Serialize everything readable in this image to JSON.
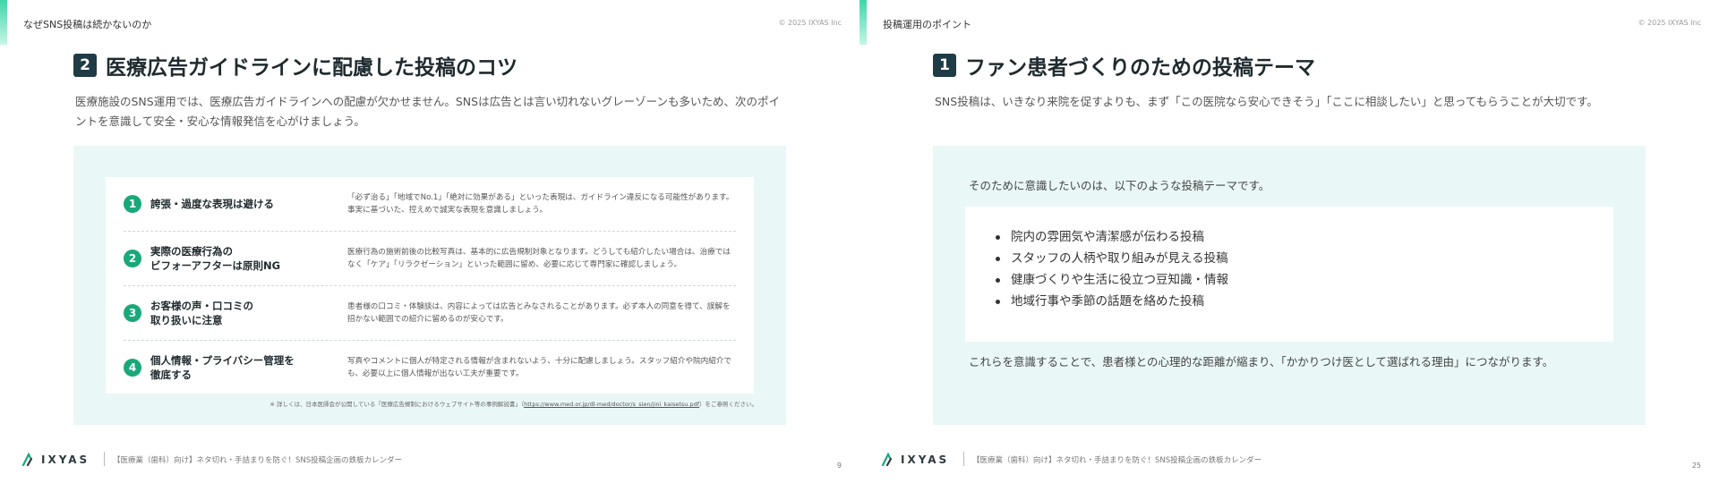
{
  "brand": {
    "accent": "#3dd6a8",
    "number_bg": "#1f3b45",
    "tip_number": "#1aa87a",
    "panel_bg": "#eaf7f7"
  },
  "left": {
    "section_label": "なぜSNS投稿は続かないのか",
    "copyright": "© 2025 IXYAS Inc",
    "title_number": "2",
    "title": "医療広告ガイドラインに配慮した投稿のコツ",
    "intro": "医療施設のSNS運用では、医療広告ガイドラインへの配慮が欠かせません。SNSは広告とは言い切れないグレーゾーンも多いため、次のポイントを意識して安全・安心な情報発信を心がけましょう。",
    "tips": [
      {
        "number": "1",
        "heading": "誇張・過度な表現は避ける",
        "description": "「必ず治る」「地域でNo.1」「絶対に効果がある」といった表現は、ガイドライン違反になる可能性があります。事実に基づいた、控えめで誠実な表現を意識しましょう。"
      },
      {
        "number": "2",
        "heading": "実際の医療行為の\nビフォーアフターは原則NG",
        "description": "医療行為の施術前後の比較写真は、基本的に広告規制対象となります。どうしても紹介したい場合は、治療ではなく「ケア」「リラクゼーション」といった範囲に留め、必要に応じて専門家に確認しましょう。"
      },
      {
        "number": "3",
        "heading": "お客様の声・口コミの\n取り扱いに注意",
        "description": "患者様の口コミ・体験談は、内容によっては広告とみなされることがあります。必ず本人の同意を得て、誤解を招かない範囲での紹介に留めるのが安心です。"
      },
      {
        "number": "4",
        "heading": "個人情報・プライバシー管理を\n徹底する",
        "description": "写真やコメントに個人が特定される情報が含まれないよう、十分に配慮しましょう。スタッフ紹介や院内紹介でも、必要以上に個人情報が出ない工夫が重要です。"
      }
    ],
    "note_prefix": "※ 詳しくは、日本医師会が公開している「医療広告規制におけるウェブサイト等の事例解説書」（",
    "note_link": "https://www.med.or.jp/dl-med/doctor/s_sien/jini_kaisetsu.pdf",
    "note_suffix": "）をご参照ください。",
    "footer_logo": "IXYAS",
    "footer_text": "【医療業（歯科）向け】ネタ切れ・手詰まりを防ぐ！SNS投稿企画の鉄板カレンダー",
    "page_number": "9"
  },
  "right": {
    "section_label": "投稿運用のポイント",
    "copyright": "© 2025 IXYAS Inc",
    "title_number": "1",
    "title": "ファン患者づくりのための投稿テーマ",
    "intro": "SNS投稿は、いきなり来院を促すよりも、まず「この医院なら安心できそう」「ここに相談したい」と思ってもらうことが大切です。",
    "lead": "そのために意識したいのは、以下のような投稿テーマです。",
    "bullets": [
      "院内の雰囲気や清潔感が伝わる投稿",
      "スタッフの人柄や取り組みが見える投稿",
      "健康づくりや生活に役立つ豆知識・情報",
      "地域行事や季節の話題を絡めた投稿"
    ],
    "closing": "これらを意識することで、患者様との心理的な距離が縮まり、「かかりつけ医として選ばれる理由」につながります。",
    "footer_logo": "IXYAS",
    "footer_text": "【医療業（歯科）向け】ネタ切れ・手詰まりを防ぐ！SNS投稿企画の鉄板カレンダー",
    "page_number": "25"
  }
}
